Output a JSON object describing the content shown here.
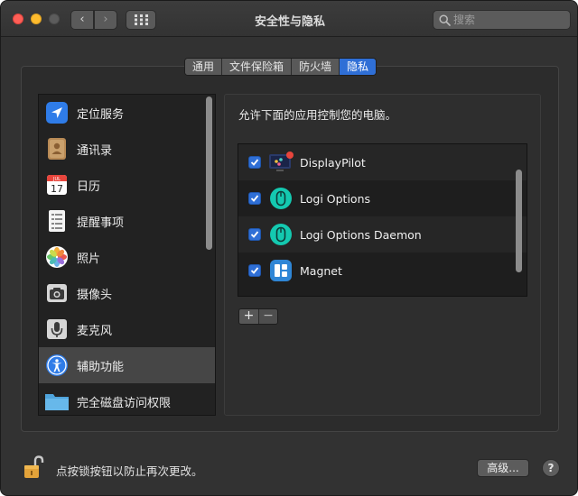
{
  "window": {
    "title": "安全性与隐私",
    "search_placeholder": "搜索"
  },
  "tabs": [
    {
      "label": "通用",
      "active": false
    },
    {
      "label": "文件保险箱",
      "active": false
    },
    {
      "label": "防火墙",
      "active": false
    },
    {
      "label": "隐私",
      "active": true
    }
  ],
  "categories": [
    {
      "label": "定位服务",
      "icon": "location-arrow-icon"
    },
    {
      "label": "通讯录",
      "icon": "contacts-book-icon"
    },
    {
      "label": "日历",
      "icon": "calendar-icon",
      "day": "17",
      "month": "JUL"
    },
    {
      "label": "提醒事项",
      "icon": "reminders-list-icon"
    },
    {
      "label": "照片",
      "icon": "photos-flower-icon"
    },
    {
      "label": "摄像头",
      "icon": "camera-icon"
    },
    {
      "label": "麦克风",
      "icon": "microphone-icon"
    },
    {
      "label": "辅助功能",
      "icon": "accessibility-icon",
      "selected": true
    },
    {
      "label": "完全磁盘访问权限",
      "icon": "folder-icon"
    }
  ],
  "main": {
    "prompt": "允许下面的应用控制您的电脑。",
    "apps": [
      {
        "name": "DisplayPilot",
        "checked": true,
        "icon": "displaypilot-app-icon"
      },
      {
        "name": "Logi Options",
        "checked": true,
        "icon": "logi-mouse-app-icon"
      },
      {
        "name": "Logi Options Daemon",
        "checked": true,
        "icon": "logi-mouse-app-icon"
      },
      {
        "name": "Magnet",
        "checked": true,
        "icon": "magnet-app-icon"
      }
    ],
    "add_label": "+",
    "remove_label": "−"
  },
  "footer": {
    "lock_text": "点按锁按钮以防止再次更改。",
    "advanced_label": "高级...",
    "help_label": "?"
  },
  "colors": {
    "accent": "#2f6fd6",
    "window_bg": "#323232",
    "list_bg": "#222222",
    "selected_row": "#464646"
  }
}
